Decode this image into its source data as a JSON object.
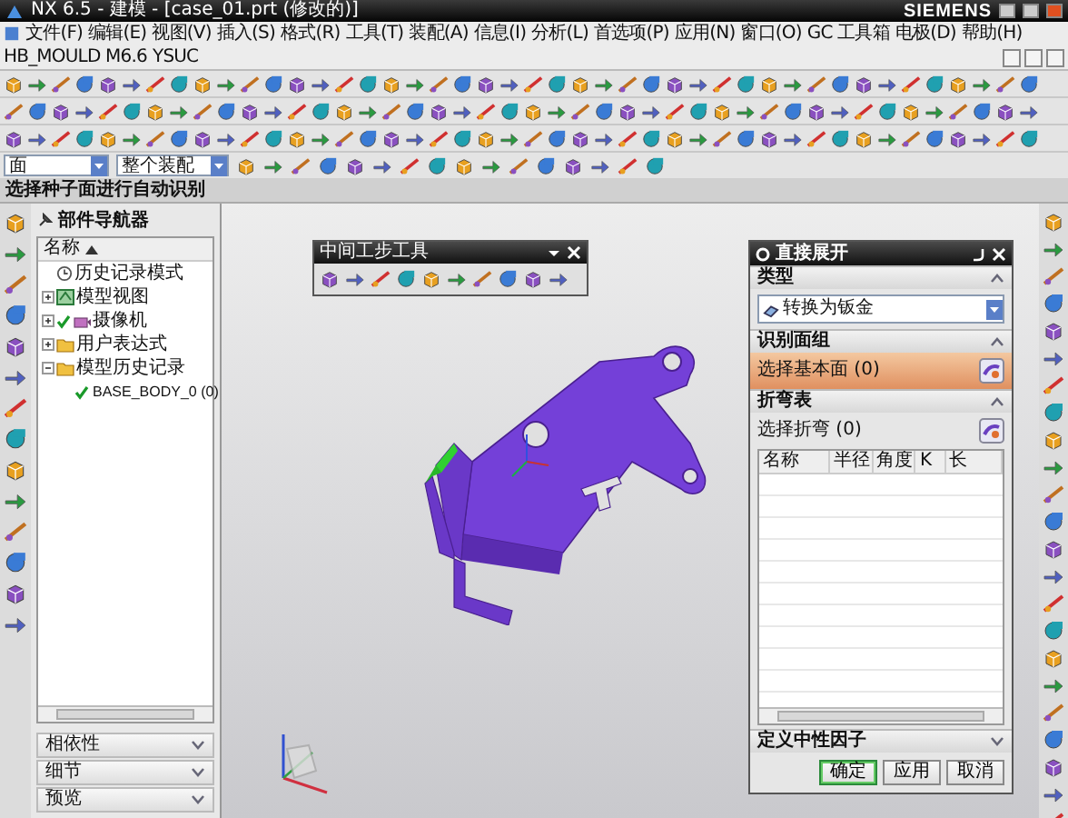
{
  "window": {
    "title": "NX 6.5 - 建模 - [case_01.prt (修改的)]",
    "brand": "SIEMENS"
  },
  "menu": [
    "文件(F)",
    "编辑(E)",
    "视图(V)",
    "插入(S)",
    "格式(R)",
    "工具(T)",
    "装配(A)",
    "信息(I)",
    "分析(L)",
    "首选项(P)",
    "应用(N)",
    "窗口(O)",
    "GC 工具箱",
    "电极(D)",
    "帮助(H)",
    "HB_MOULD M6.6",
    "YSUC"
  ],
  "selection_bar": {
    "filter": "面",
    "scope": "整个装配"
  },
  "cue_line": "选择种子面进行自动识别",
  "part_navigator": {
    "title": "部件导航器",
    "column": "名称",
    "items": [
      {
        "label": "历史记录模式",
        "kind": "clock",
        "checked": false
      },
      {
        "label": "模型视图",
        "kind": "views",
        "expanded": false,
        "checked": false
      },
      {
        "label": "摄像机",
        "kind": "camera",
        "expanded": false,
        "checked": true
      },
      {
        "label": "用户表达式",
        "kind": "folder",
        "expanded": false,
        "checked": false
      },
      {
        "label": "模型历史记录",
        "kind": "folder",
        "expanded": true,
        "checked": false,
        "children": [
          {
            "label": "BASE_BODY_0 (0)",
            "kind": "body",
            "checked": true
          }
        ]
      }
    ],
    "panels": [
      {
        "label": "相依性",
        "expanded": false
      },
      {
        "label": "细节",
        "expanded": false
      },
      {
        "label": "预览",
        "expanded": false
      }
    ]
  },
  "floating_toolbar": {
    "title": "中间工步工具"
  },
  "dialog": {
    "title": "直接展开",
    "sections": [
      {
        "title": "类型",
        "expanded": true,
        "kind": "dropdown",
        "value": "转换为钣金"
      },
      {
        "title": "识别面组",
        "expanded": true,
        "kind": "selection",
        "label": "选择基本面 (0)",
        "active": true
      },
      {
        "title": "折弯表",
        "expanded": true,
        "kind": "table",
        "label": "选择折弯 (0)",
        "active": false,
        "columns": [
          "名称",
          "半径",
          "角度",
          "K",
          "长"
        ]
      },
      {
        "title": "定义中性因子",
        "expanded": false
      }
    ],
    "buttons": [
      {
        "label": "确定",
        "default": true
      },
      {
        "label": "应用",
        "default": false
      },
      {
        "label": "取消",
        "default": false
      }
    ]
  }
}
